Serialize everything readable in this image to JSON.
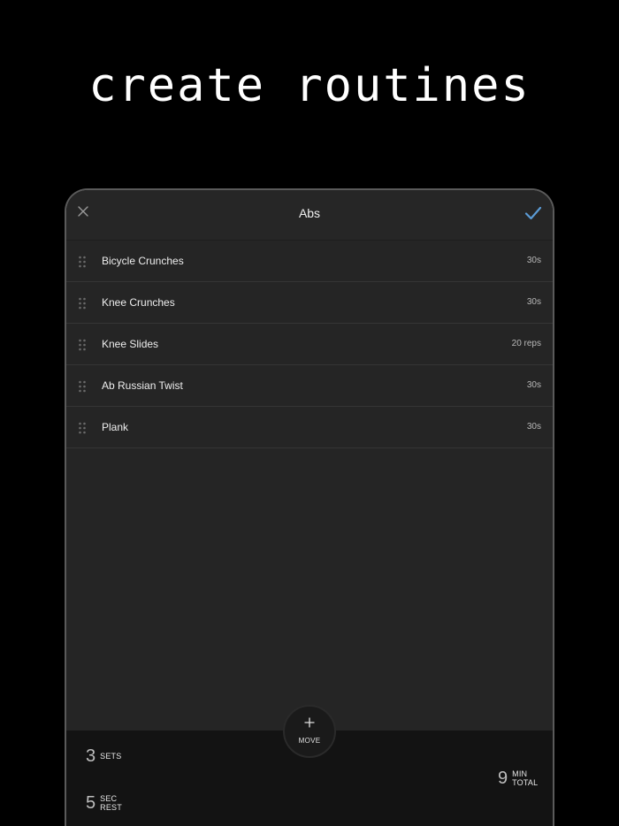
{
  "headline": "create routines",
  "header": {
    "title": "Abs",
    "close_icon": "close-icon",
    "confirm_icon": "checkmark-icon",
    "accent_color": "#5b9bd5"
  },
  "exercises": [
    {
      "name": "Bicycle Crunches",
      "meta": "30s"
    },
    {
      "name": "Knee Crunches",
      "meta": "30s"
    },
    {
      "name": "Knee Slides",
      "meta": "20 reps"
    },
    {
      "name": "Ab Russian Twist",
      "meta": "30s"
    },
    {
      "name": "Plank",
      "meta": "30s"
    }
  ],
  "fab": {
    "icon": "plus-icon",
    "label": "MOVE"
  },
  "stats": {
    "sets": {
      "value": "3",
      "label": "SETS"
    },
    "rest": {
      "value": "5",
      "label_line1": "SEC",
      "label_line2": "REST"
    },
    "total": {
      "value": "9",
      "label_line1": "MIN",
      "label_line2": "TOTAL"
    }
  }
}
